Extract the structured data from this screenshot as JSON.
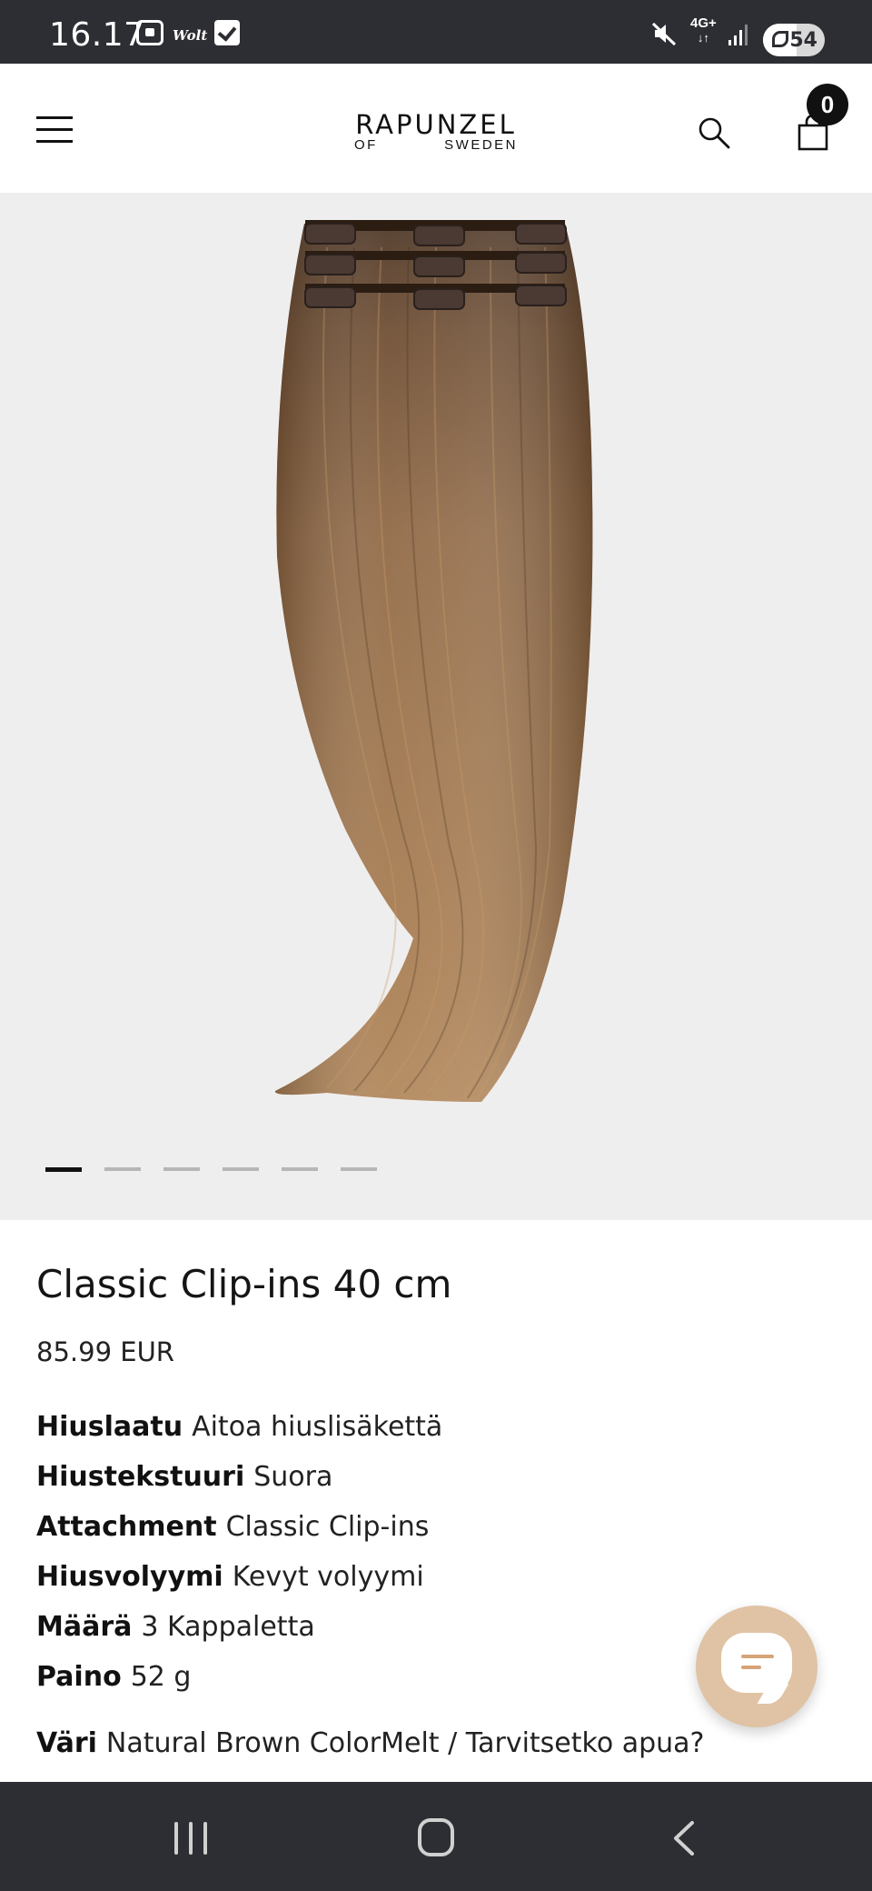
{
  "status_bar": {
    "time": "16.17",
    "app_label": "Wolt",
    "network": "4G+",
    "battery": "54",
    "battery_level_percent": 54
  },
  "header": {
    "logo_main": "RAPUNZEL",
    "logo_sub_left": "OF",
    "logo_sub_right": "SWEDEN",
    "cart_count": "0"
  },
  "gallery": {
    "image_icon": "hair-extension-clip-ins",
    "slide_count": 6,
    "active_slide": 1
  },
  "product": {
    "title": "Classic Clip-ins 40 cm",
    "price": "85.99 EUR",
    "attributes": [
      {
        "label": "Hiuslaatu",
        "value": "Aitoa hiuslisäkettä"
      },
      {
        "label": "Hiustekstuuri",
        "value": "Suora"
      },
      {
        "label": "Attachment",
        "value": "Classic Clip-ins"
      },
      {
        "label": "Hiusvolyymi",
        "value": "Kevyt volyymi"
      },
      {
        "label": "Määrä",
        "value": "3 Kappaletta"
      },
      {
        "label": "Paino",
        "value": "52 g"
      }
    ],
    "color_label": "Väri",
    "color_value": "Natural Brown ColorMelt / Tarvitsetko apua?"
  },
  "chat": {
    "icon": "chat-icon"
  },
  "colors": {
    "status_bar_bg": "#2d2e33",
    "gallery_bg": "#efeeee",
    "chat_button": "#dfc3a4",
    "text": "#111111"
  }
}
